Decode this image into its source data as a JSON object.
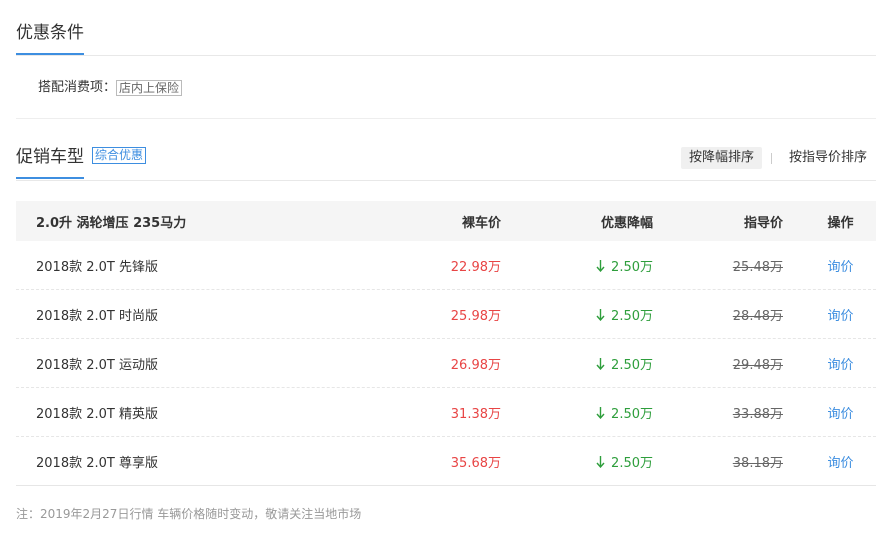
{
  "conditions": {
    "title": "优惠条件",
    "label": "搭配消费项：",
    "tag": "店内上保险"
  },
  "promo": {
    "title": "促销车型",
    "badge": "综合优惠",
    "sort": [
      {
        "label": "按降幅排序",
        "active": true
      },
      {
        "label": "按指导价排序",
        "active": false
      }
    ]
  },
  "table": {
    "headers": {
      "name": "2.0升 涡轮增压 235马力",
      "price": "裸车价",
      "drop": "优惠降幅",
      "guide": "指导价",
      "op": "操作"
    },
    "rows": [
      {
        "name": "2018款 2.0T 先锋版",
        "price": "22.98万",
        "drop": "2.50万",
        "guide": "25.48万",
        "op": "询价"
      },
      {
        "name": "2018款 2.0T 时尚版",
        "price": "25.98万",
        "drop": "2.50万",
        "guide": "28.48万",
        "op": "询价"
      },
      {
        "name": "2018款 2.0T 运动版",
        "price": "26.98万",
        "drop": "2.50万",
        "guide": "29.48万",
        "op": "询价"
      },
      {
        "name": "2018款 2.0T 精英版",
        "price": "31.38万",
        "drop": "2.50万",
        "guide": "33.88万",
        "op": "询价"
      },
      {
        "name": "2018款 2.0T 尊享版",
        "price": "35.68万",
        "drop": "2.50万",
        "guide": "38.18万",
        "op": "询价"
      }
    ]
  },
  "note": "注：2019年2月27日行情 车辆价格随时变动，敬请关注当地市场",
  "colors": {
    "accent": "#3d8ee0",
    "price": "#e84545",
    "drop": "#2e9e3c"
  },
  "icons": {
    "drop": "arrow-down-icon"
  }
}
